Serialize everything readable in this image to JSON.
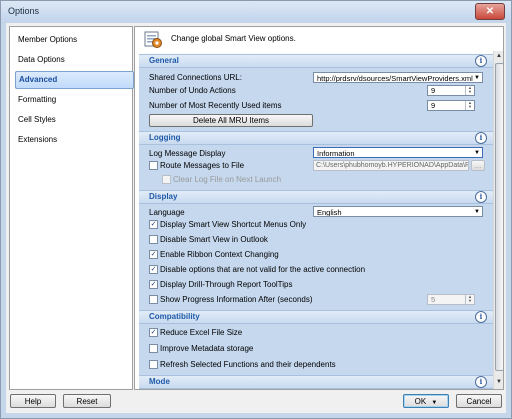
{
  "window": {
    "title": "Options",
    "close_label": "✕"
  },
  "sidebar": {
    "items": [
      {
        "label": "Member Options"
      },
      {
        "label": "Data Options"
      },
      {
        "label": "Advanced"
      },
      {
        "label": "Formatting"
      },
      {
        "label": "Cell Styles"
      },
      {
        "label": "Extensions"
      }
    ],
    "selected": "Advanced"
  },
  "header": {
    "text": "Change global Smart View options."
  },
  "general": {
    "title": "General",
    "shared_conn_label": "Shared Connections URL:",
    "shared_conn_value": "http://prdsrv/dsources/SmartViewProviders.xml",
    "undo_label": "Number of Undo Actions",
    "undo_value": "9",
    "mru_label": "Number of Most Recently Used items",
    "mru_value": "9",
    "delete_mru": "Delete All MRU Items"
  },
  "logging": {
    "title": "Logging",
    "log_display_label": "Log Message Display",
    "log_display_value": "Information",
    "route_label": "Route Messages to File",
    "route_path": "C:\\Users\\phubhomoyb.HYPERIONAD\\AppData\\Roan",
    "browse": "...",
    "clear_label": "Clear Log File on Next Launch"
  },
  "display": {
    "title": "Display",
    "language_label": "Language",
    "language_value": "English",
    "options": [
      {
        "label": "Display Smart View Shortcut Menus Only",
        "checked": true
      },
      {
        "label": "Disable Smart View in Outlook",
        "checked": false
      },
      {
        "label": "Enable Ribbon Context Changing",
        "checked": true
      },
      {
        "label": "Disable options that are not valid for the active connection",
        "checked": true
      },
      {
        "label": "Display Drill-Through Report ToolTips",
        "checked": true
      },
      {
        "label": "Show Progress Information After (seconds)",
        "checked": false
      }
    ],
    "progress_value": "5"
  },
  "compatibility": {
    "title": "Compatibility",
    "options": [
      {
        "label": "Reduce Excel File Size",
        "checked": true
      },
      {
        "label": "Improve Metadata storage",
        "checked": false
      },
      {
        "label": "Refresh Selected Functions and their dependents",
        "checked": false
      }
    ]
  },
  "mode": {
    "title": "Mode"
  },
  "info_glyph": "i",
  "check_glyph": "✓",
  "footer": {
    "help": "Help",
    "reset": "Reset",
    "ok": "OK",
    "cancel": "Cancel"
  }
}
